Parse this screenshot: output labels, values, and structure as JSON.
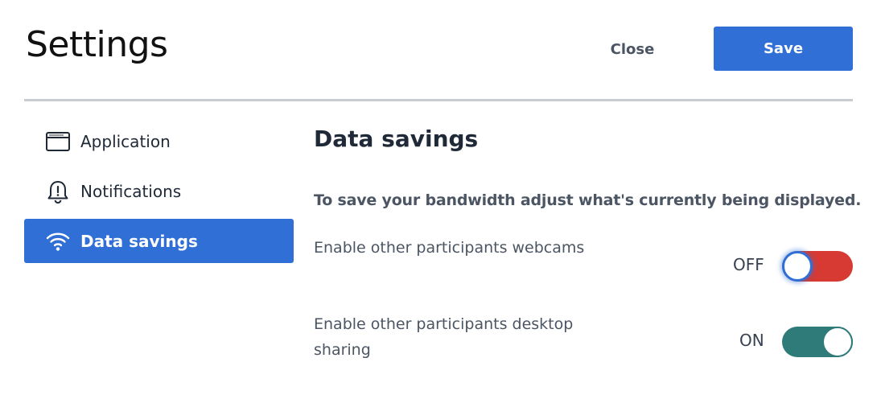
{
  "header": {
    "title": "Settings",
    "close_label": "Close",
    "save_label": "Save"
  },
  "sidebar": {
    "items": [
      {
        "label": "Application",
        "icon": "application-window-icon",
        "active": false
      },
      {
        "label": "Notifications",
        "icon": "bell-alert-icon",
        "active": false
      },
      {
        "label": "Data savings",
        "icon": "wifi-icon",
        "active": true
      }
    ]
  },
  "main": {
    "title": "Data savings",
    "description": "To save your bandwidth adjust what's currently being displayed.",
    "settings": [
      {
        "label": "Enable other participants webcams",
        "state": "OFF",
        "enabled": false
      },
      {
        "label": "Enable other participants desktop sharing",
        "state": "ON",
        "enabled": true
      }
    ]
  },
  "colors": {
    "accent": "#2f6fd6",
    "toggle_off": "#d63a33",
    "toggle_on": "#2f7b7a"
  }
}
